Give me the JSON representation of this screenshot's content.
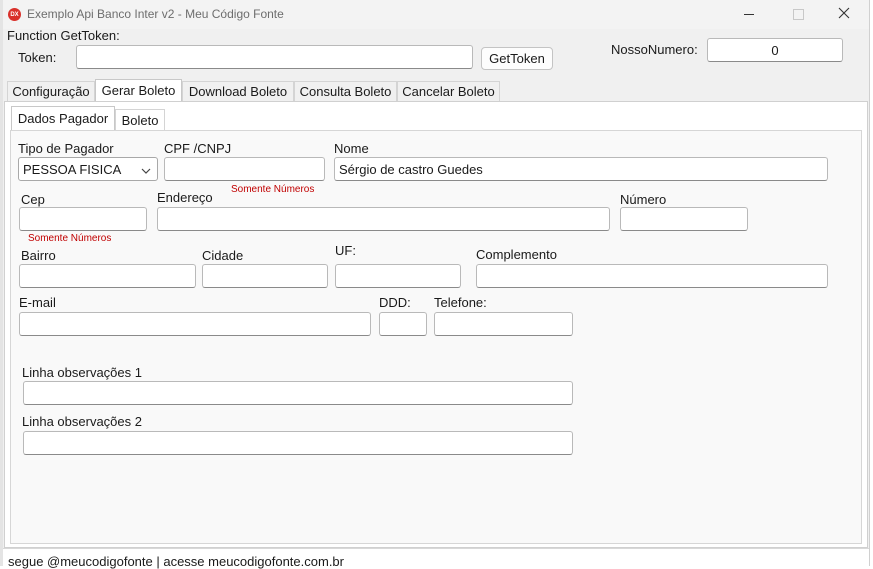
{
  "window": {
    "title": "Exemplo Api Banco Inter v2 - Meu Código Fonte",
    "app_icon": "delphi-icon",
    "controls": [
      "minimize-icon",
      "maximize-icon",
      "close-icon"
    ]
  },
  "gettoken": {
    "group_label": "Function GetToken:",
    "token_label": "Token:",
    "token_value": "",
    "button_label": "GetToken",
    "nosso_numero_label": "NossoNumero:",
    "nosso_numero_value": "0"
  },
  "main_tabs": [
    "Configuração",
    "Gerar Boleto",
    "Download Boleto",
    "Consulta Boleto",
    "Cancelar Boleto"
  ],
  "main_tab_active": "Gerar Boleto",
  "sub_tabs": [
    "Dados Pagador",
    "Boleto"
  ],
  "sub_tab_active": "Dados Pagador",
  "form": {
    "tipo_pagador_label": "Tipo de Pagador",
    "tipo_pagador_value": "PESSOA FISICA",
    "cpf_label": "CPF /CNPJ",
    "cpf_value": "",
    "cpf_hint": "Somente Números",
    "nome_label": "Nome",
    "nome_value": "Sérgio de castro Guedes",
    "cep_label": "Cep",
    "cep_value": "",
    "cep_hint": "Somente Números",
    "endereco_label": "Endereço",
    "endereco_value": "",
    "numero_label": "Número",
    "numero_value": "",
    "bairro_label": "Bairro",
    "bairro_value": "",
    "cidade_label": "Cidade",
    "cidade_value": "",
    "uf_label": "UF:",
    "uf_value": "",
    "complemento_label": "Complemento",
    "complemento_value": "",
    "email_label": "E-mail",
    "email_value": "",
    "ddd_label": "DDD:",
    "ddd_value": "",
    "telefone_label": "Telefone:",
    "telefone_value": "",
    "obs1_label": "Linha observações 1",
    "obs1_value": "",
    "obs2_label": "Linha observações 2",
    "obs2_value": ""
  },
  "status_bar": "segue @meucodigofonte | acesse meucodigofonte.com.br",
  "colors": {
    "titlebar_bg": "#f3f3f3",
    "window_bg": "#f0f0f0",
    "hint_red": "#c00000",
    "icon_red": "#d9312b"
  }
}
